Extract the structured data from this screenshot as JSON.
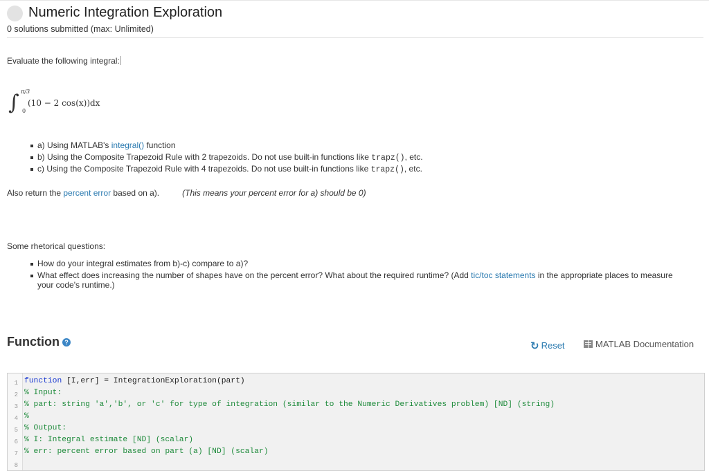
{
  "header": {
    "title": "Numeric Integration Exploration",
    "subtitle": "0 solutions submitted (max: Unlimited)"
  },
  "problem": {
    "intro": "Evaluate the following integral:",
    "integral": {
      "upper": "π/3",
      "lower": "0",
      "expression": "(10 − 2 cos(x))dx"
    },
    "tasks": [
      {
        "prefix": "a) Using MATLAB's ",
        "link": "integral()",
        "suffix": " function"
      },
      {
        "prefix": "b) Using the Composite Trapezoid Rule with 2 trapezoids. Do not use built-in functions like ",
        "code": "trapz()",
        "suffix": ", etc."
      },
      {
        "prefix": "c) Using the Composite Trapezoid Rule with 4 trapezoids. Do not use built-in functions like ",
        "code": "trapz()",
        "suffix": ", etc."
      }
    ],
    "also_return": {
      "prefix": "Also return the ",
      "link": "percent error",
      "suffix": " based on a).",
      "note": "(This means your percent error for a) should be 0)"
    },
    "rhetorical_heading": "Some rhetorical questions:",
    "questions": [
      {
        "text": "How do your integral estimates from b)-c) compare to a)?"
      },
      {
        "prefix": "What effect does increasing the number of shapes have on the percent error? What about the required runtime? (Add ",
        "link": "tic/toc statements",
        "suffix": " in the appropriate places to measure",
        "line2": "your code's runtime.)"
      }
    ]
  },
  "function_section": {
    "title": "Function",
    "help_icon": "question-circle-icon",
    "reset_label": "Reset",
    "reset_icon": "refresh-icon",
    "doc_label": "MATLAB Documentation",
    "doc_icon": "book-icon"
  },
  "editor": {
    "lines": [
      {
        "num": "1",
        "kw": "function",
        "rest": " [I,err] = IntegrationExploration(part)"
      },
      {
        "num": "2",
        "comment": "% Input:"
      },
      {
        "num": "3",
        "comment": "% part: string 'a','b', or 'c' for type of integration (similar to the Numeric Derivatives problem) [ND] (string)"
      },
      {
        "num": "4",
        "comment": "%"
      },
      {
        "num": "5",
        "comment": "% Output:"
      },
      {
        "num": "6",
        "comment": "% I: Integral estimate [ND] (scalar)"
      },
      {
        "num": "7",
        "comment": "% err: percent error based on part (a) [ND] (scalar)"
      },
      {
        "num": "8",
        "comment": ""
      }
    ]
  },
  "colors": {
    "link": "#2a7ab0",
    "keyword": "#1d3bd1",
    "comment": "#1d8a3a",
    "editor_bg": "#f1f1f1",
    "help_icon": "#3b86c6"
  }
}
